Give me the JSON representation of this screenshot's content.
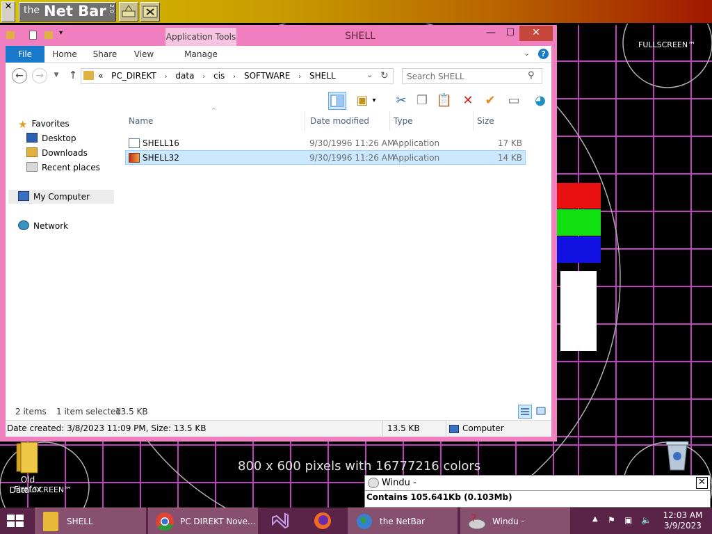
{
  "netbar": {
    "close_glyph": "✕",
    "logo_the": "the",
    "logo_title": "Net Bar",
    "logo_version": "2.0"
  },
  "desktop": {
    "fullscreen_label": "FULLSCREEN™",
    "resolution_text": "800 x 600 pixels with 16777216 colors",
    "icon_folder_label_line1": "Old Firefox",
    "icon_folder_label_line2": "Data",
    "colors": {
      "bar_red": "#e81010",
      "bar_green": "#10e010",
      "bar_blue": "#1010e0",
      "bar_white": "#ffffff",
      "grid": "#c040c0",
      "circle": "#b0b0b0"
    }
  },
  "explorer": {
    "title": "SHELL",
    "app_tools_label": "Application Tools",
    "ribbon_tabs": [
      {
        "label": "File"
      },
      {
        "label": "Home"
      },
      {
        "label": "Share"
      },
      {
        "label": "View"
      },
      {
        "label": "Manage"
      }
    ],
    "address": {
      "prefix": "«",
      "crumbs": [
        "PC_DIREKT",
        "data",
        "cis",
        "SOFTWARE",
        "SHELL"
      ]
    },
    "search_placeholder": "Search SHELL",
    "nav": {
      "favorites": "Favorites",
      "desktop": "Desktop",
      "downloads": "Downloads",
      "recent": "Recent places",
      "mycomputer": "My Computer",
      "network": "Network"
    },
    "columns": {
      "name": "Name",
      "date": "Date modified",
      "type": "Type",
      "size": "Size"
    },
    "files": [
      {
        "name": "SHELL16",
        "date": "9/30/1996 11:26 AM",
        "type": "Application",
        "size": "17 KB"
      },
      {
        "name": "SHELL32",
        "date": "9/30/1996 11:26 AM",
        "type": "Application",
        "size": "14 KB"
      }
    ],
    "status": {
      "items": "2 items",
      "selected": "1 item selected",
      "size": "13.5 KB"
    },
    "details": {
      "created": "Date created: 3/8/2023 11:09 PM, Size: 13.5 KB",
      "size": "13.5 KB",
      "location": "Computer"
    },
    "colors": {
      "frame": "#f07fc0",
      "accent": "#1979ca",
      "selection": "#cce8ff",
      "close": "#c7463c"
    }
  },
  "windu": {
    "title": "Windu -",
    "content": "Contains 105.641Kb (0.103Mb)",
    "close_glyph": "✕"
  },
  "taskbar": {
    "items": [
      {
        "label": "SHELL"
      },
      {
        "label": "PC DIREKT Nove..."
      },
      {
        "label": ""
      },
      {
        "label": ""
      },
      {
        "label": "the NetBar"
      },
      {
        "label": "Windu -"
      }
    ],
    "clock_time": "12:03 AM",
    "clock_date": "3/9/2023",
    "colors": {
      "background": "#5a2448",
      "active": "#87506f"
    }
  }
}
